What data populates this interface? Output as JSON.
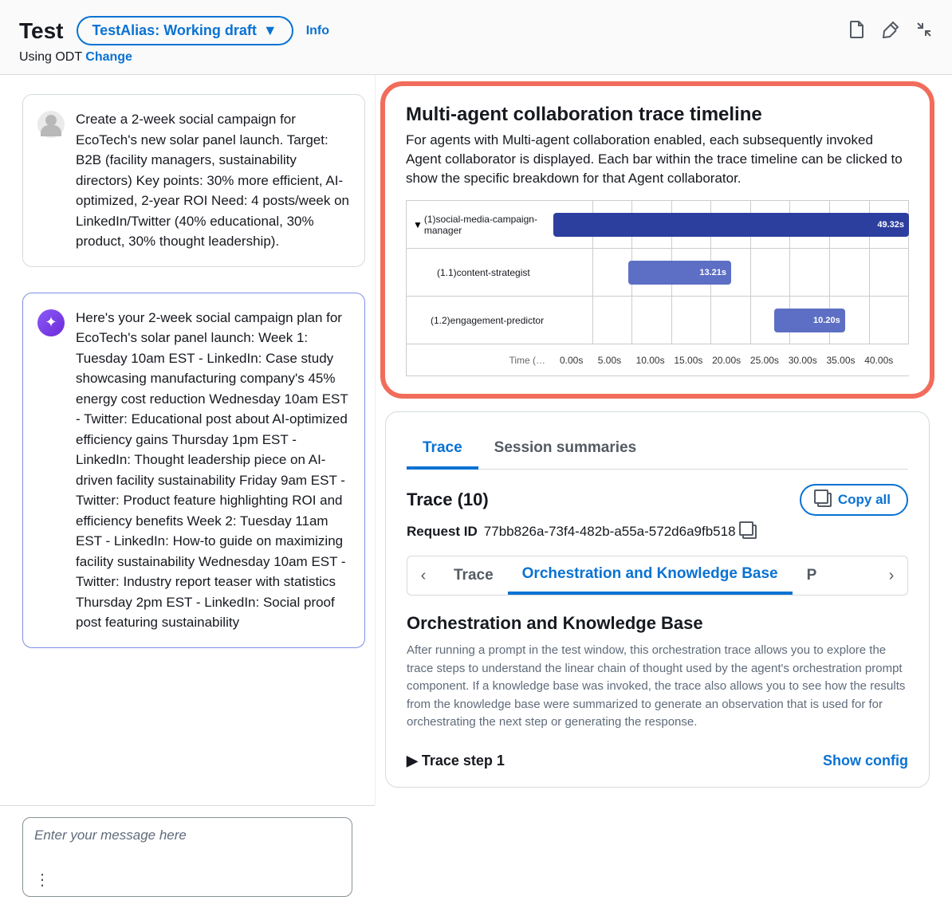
{
  "header": {
    "title": "Test",
    "alias_label": "TestAlias: Working draft",
    "info": "Info",
    "sub_prefix": "Using ODT ",
    "change": "Change"
  },
  "chat": {
    "user_msg": "Create a 2-week social campaign for EcoTech's new solar panel launch. Target: B2B (facility managers, sustainability directors) Key points: 30% more efficient, AI-optimized, 2-year ROI Need: 4 posts/week on LinkedIn/Twitter (40% educational, 30% product, 30% thought leadership).",
    "agent_msg": "Here's your 2-week social campaign plan for EcoTech's solar panel launch: Week 1: Tuesday 10am EST - LinkedIn: Case study showcasing manufacturing company's 45% energy cost reduction Wednesday 10am EST - Twitter: Educational post about AI-optimized efficiency gains Thursday 1pm EST - LinkedIn: Thought leadership piece on AI-driven facility sustainability Friday 9am EST - Twitter: Product feature highlighting ROI and efficiency benefits Week 2: Tuesday 11am EST - LinkedIn: How-to guide on maximizing facility sustainability Wednesday 10am EST - Twitter: Industry report teaser with statistics Thursday 2pm EST - LinkedIn: Social proof post featuring sustainability",
    "input_placeholder": "Enter your message here"
  },
  "timeline": {
    "title": "Multi-agent collaboration trace timeline",
    "desc": "For agents with Multi-agent collaboration enabled, each subsequently invoked Agent collaborator is displayed. Each bar within the trace timeline can be clicked to show the specific breakdown for that Agent collaborator.",
    "axis_label": "Time (…"
  },
  "chart_data": {
    "type": "gantt",
    "title": "Multi-agent collaboration trace timeline",
    "xlabel": "Time (s)",
    "ylabel": "",
    "xlim": [
      0,
      45
    ],
    "ticks": [
      "0.00s",
      "5.00s",
      "10.00s",
      "15.00s",
      "20.00s",
      "25.00s",
      "30.00s",
      "35.00s",
      "40.00s"
    ],
    "series": [
      {
        "name": "(1)social-media-campaign-manager",
        "start": 0.0,
        "duration": 49.32,
        "label": "49.32s",
        "color": "#2c3e9e"
      },
      {
        "name": "(1.1)content-strategist",
        "start": 10.7,
        "duration": 13.21,
        "label": "13.21s",
        "color": "#5d6fc4"
      },
      {
        "name": "(1.2)engagement-predictor",
        "start": 29.6,
        "duration": 10.2,
        "label": "10.20s",
        "color": "#5d6fc4"
      }
    ]
  },
  "details": {
    "tabs": {
      "trace": "Trace",
      "sessions": "Session summaries"
    },
    "trace_count": "Trace (10)",
    "copy_all": "Copy all",
    "req_label": "Request ID",
    "req_value": "77bb826a-73f4-482b-a55a-572d6a9fb518",
    "subtabs": {
      "trace": "Trace",
      "orch": "Orchestration and Knowledge Base",
      "next": "P"
    },
    "section_title": "Orchestration and Knowledge Base",
    "section_desc": "After running a prompt in the test window, this orchestration trace allows you to explore the trace steps to understand the linear chain of thought used by the agent's orchestration prompt component. If a knowledge base was invoked, the trace also allows you to see how the results from the knowledge base were summarized to generate an observation that is used for for orchestrating the next step or generating the response.",
    "step1": "Trace step 1",
    "show_config": "Show config"
  }
}
